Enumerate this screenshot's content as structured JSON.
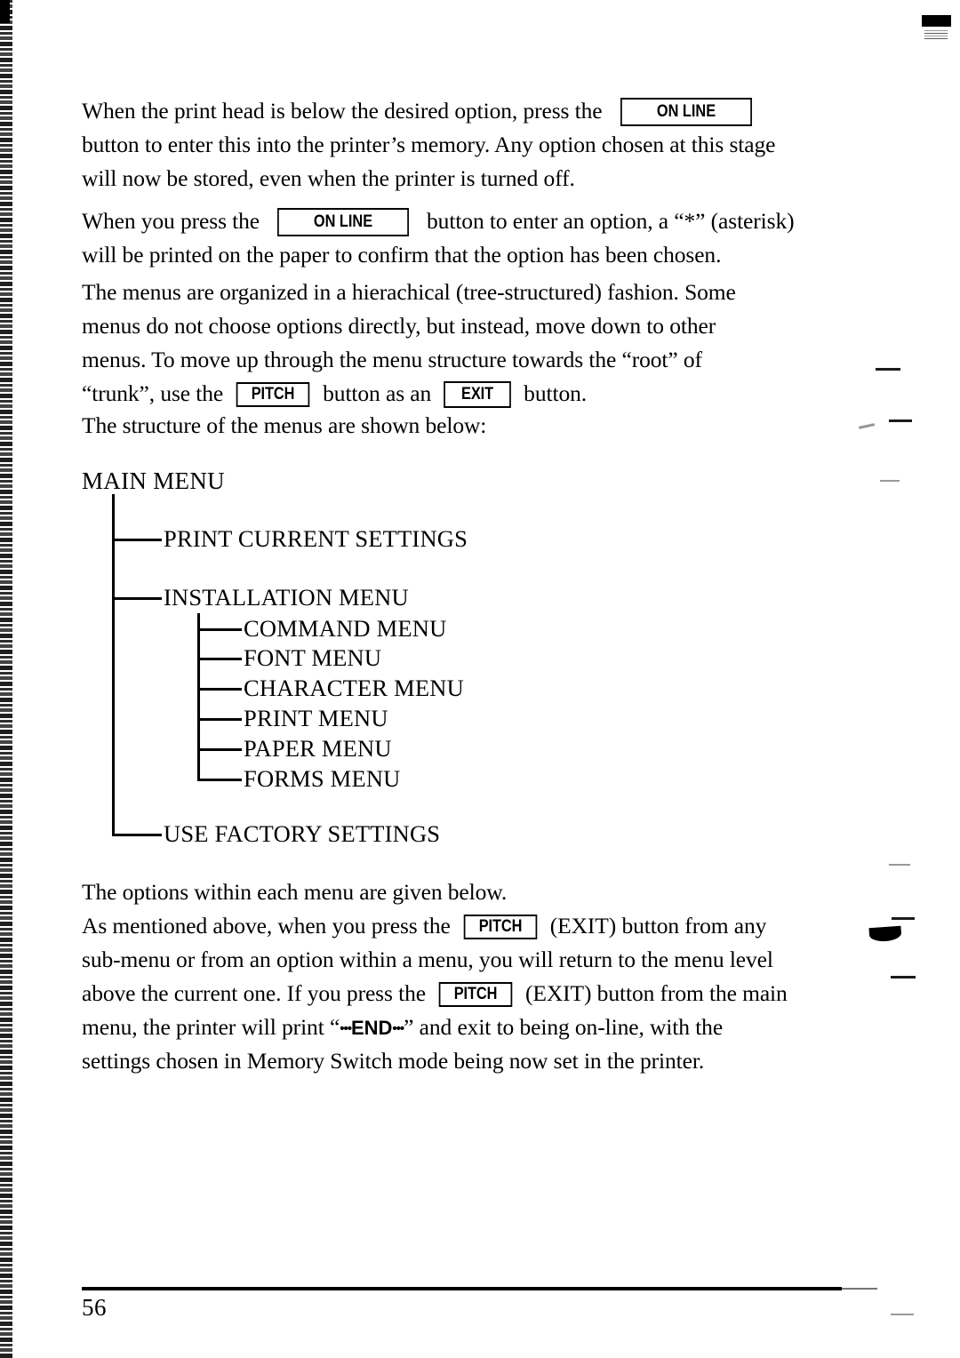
{
  "page": {
    "number": "56"
  },
  "keys": {
    "online": "ON LINE",
    "pitch": "PITCH",
    "exit": "EXIT"
  },
  "paragraphs": {
    "p1": {
      "l1_a": "When the print head is below the desired option, press the",
      "l2": "button to enter this into the printer’s memory. Any option chosen at this stage",
      "l3": "will now be stored, even when the printer is turned off."
    },
    "p2": {
      "l1_a": "When you press the",
      "l1_b": "button to enter an option, a “*” (asterisk)",
      "l2": "will be printed on the paper to confirm that the option has been chosen."
    },
    "p3": {
      "l1": "The menus are organized in a hierachical (tree-structured) fashion. Some",
      "l2": "menus do not choose options directly, but instead, move down to other",
      "l3": "menus. To move up through the menu structure towards the “root” of",
      "l4_a": "“trunk”, use the",
      "l4_b": "button as an",
      "l4_c": "button."
    },
    "p4": {
      "l1": "The structure of the menus are shown below:"
    },
    "p5": {
      "l1": "The options within each menu are given below.",
      "l2_a": "As mentioned above, when you press the",
      "l2_b": "(EXIT) button from any",
      "l3": "sub-menu or from an option within a menu, you will return to the menu level",
      "l4_a": "above the current one. If you press the",
      "l4_b": "(EXIT) button from the main",
      "l5_a": "menu, the printer will print “",
      "l5_dots_left": "•••",
      "l5_end": "END",
      "l5_dots_right": "•••",
      "l5_b": "” and exit to being on-line, with the",
      "l6": "settings chosen in Memory Switch mode being now set in the printer."
    }
  },
  "menu_tree": {
    "root": "MAIN MENU",
    "children": [
      {
        "label": "PRINT CURRENT SETTINGS",
        "level": 1
      },
      {
        "label": "INSTALLATION MENU",
        "level": 1
      },
      {
        "label": "COMMAND MENU",
        "level": 2
      },
      {
        "label": "FONT MENU",
        "level": 2
      },
      {
        "label": "CHARACTER MENU",
        "level": 2
      },
      {
        "label": "PRINT MENU",
        "level": 2
      },
      {
        "label": "PAPER MENU",
        "level": 2
      },
      {
        "label": "FORMS MENU",
        "level": 2
      },
      {
        "label": "USE FACTORY SETTINGS",
        "level": 1
      }
    ]
  }
}
